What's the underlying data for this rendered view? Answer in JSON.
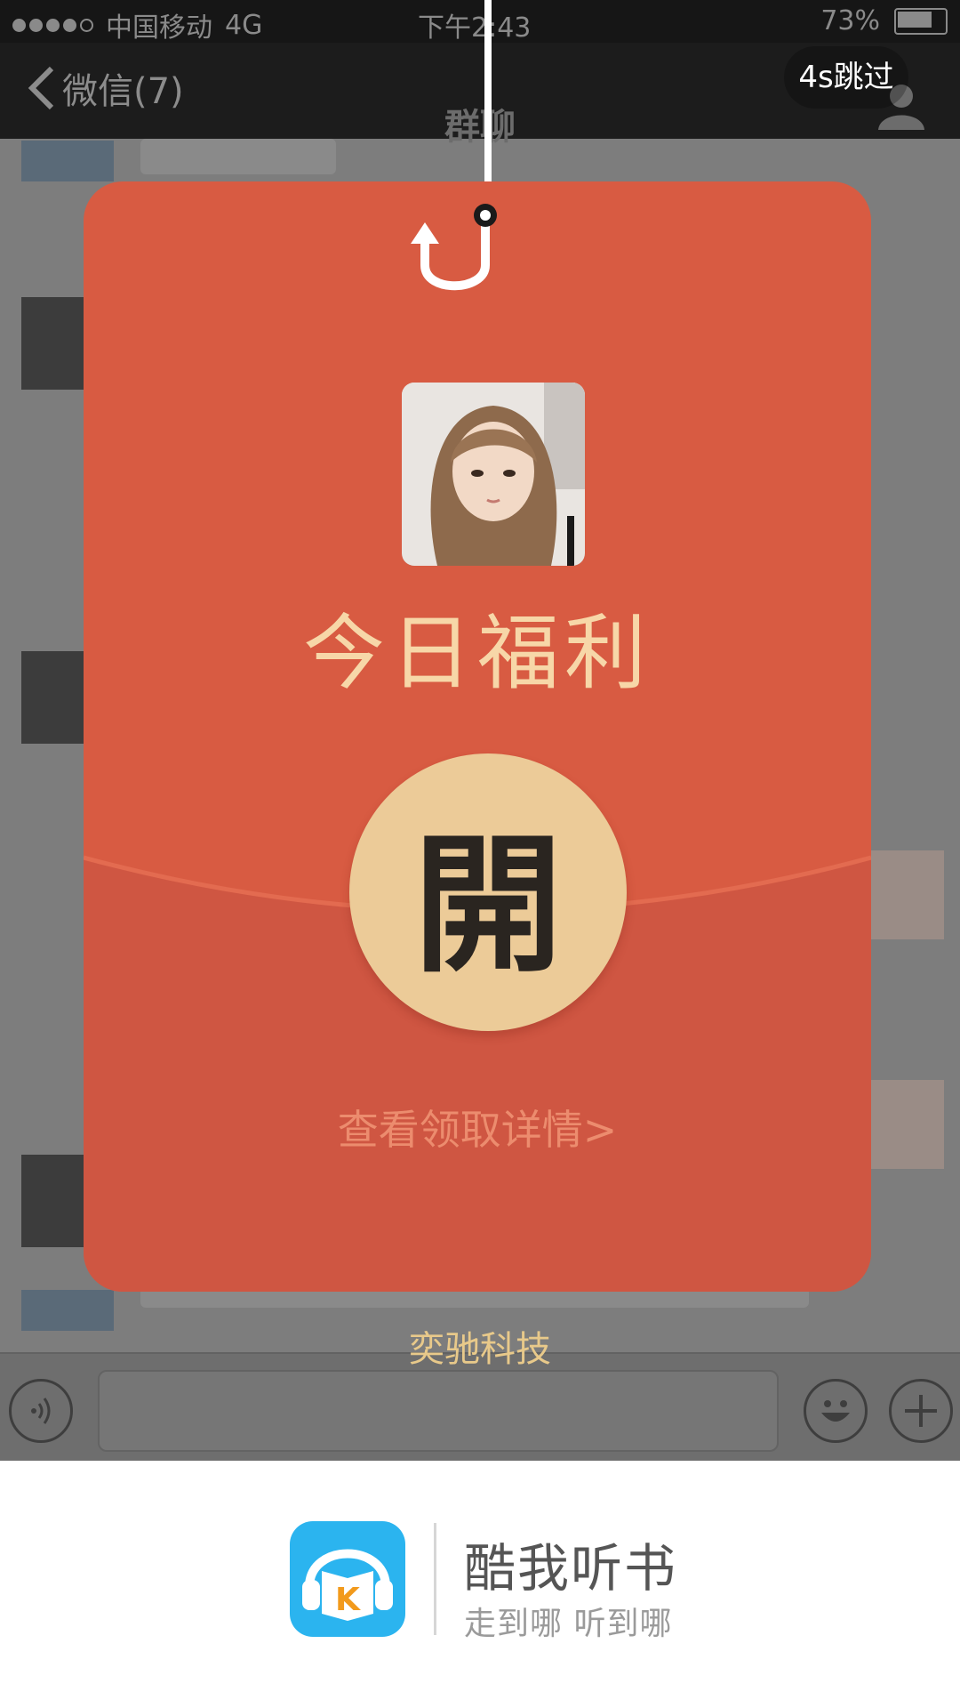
{
  "status_bar": {
    "carrier": "中国移动",
    "network": "4G",
    "time": "下午2:43",
    "battery": "73%"
  },
  "nav": {
    "back_label": "微信(7)",
    "title": "群聊"
  },
  "ad": {
    "skip_label": "4s跳过"
  },
  "envelope": {
    "title": "今日福利",
    "open_label": "開",
    "details_link": "查看领取详情>",
    "company": "奕驰科技"
  },
  "brand": {
    "name": "酷我听书",
    "slogan": "走到哪 听到哪",
    "icon_letter": "K"
  },
  "colors": {
    "envelope_red": "#d85b42",
    "button_gold": "#eccb98",
    "title_gold": "#f7d7a8",
    "link_salmon": "#ec8c6e",
    "app_icon_blue": "#2bb4ef",
    "app_icon_orange": "#f29a1c"
  }
}
